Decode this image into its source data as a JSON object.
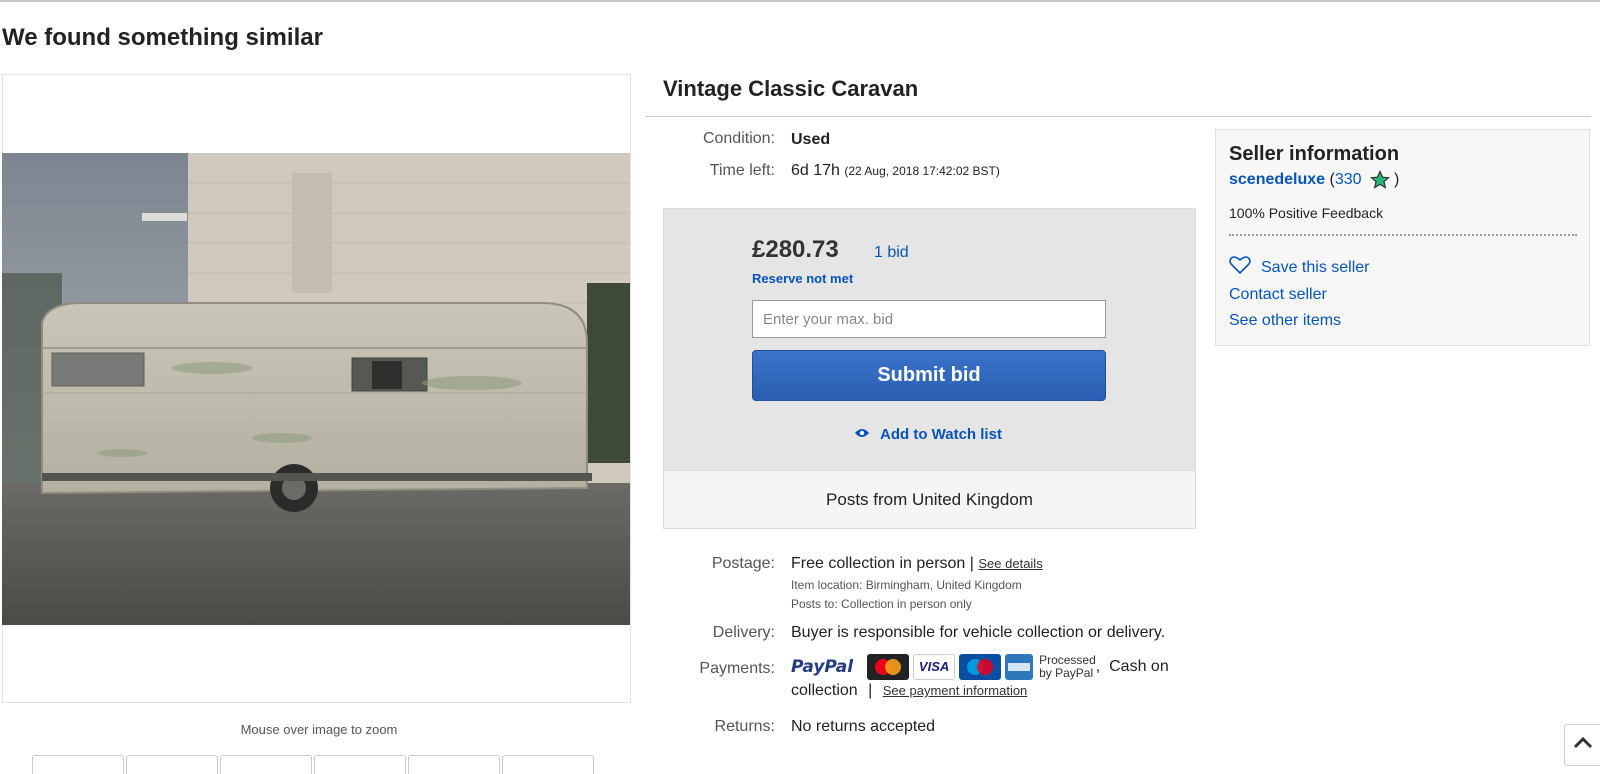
{
  "page": {
    "heading": "We found something similar"
  },
  "gallery": {
    "zoom_hint": "Mouse over image to zoom",
    "thumbnail_count": 6
  },
  "item": {
    "title": "Vintage Classic Caravan",
    "condition_label": "Condition:",
    "condition_value": "Used",
    "time_left_label": "Time left:",
    "time_left_value": "6d 17h",
    "time_left_end": "(22 Aug, 2018   17:42:02 BST)"
  },
  "bid": {
    "price": "£280.73",
    "bid_count": "1 bid",
    "reserve_status": "Reserve not met",
    "input_placeholder": "Enter your max. bid",
    "submit_label": "Submit bid",
    "watch_label": "Add to Watch list",
    "posts_from": "Posts from United Kingdom"
  },
  "shipping": {
    "postage_label": "Postage:",
    "postage_value": "Free collection in person",
    "postage_sep": "|",
    "see_details": "See details",
    "item_location": "Item location:  Birmingham, United Kingdom",
    "posts_to": "Posts to:  Collection in person only",
    "delivery_label": "Delivery:",
    "delivery_value": "Buyer is responsible for vehicle collection or delivery.",
    "payments_label": "Payments:",
    "paypal": "PayPal",
    "card_visa": "VISA",
    "processed_line1": "Processed",
    "processed_line2": "by PayPal",
    "cash_on": ",  Cash on",
    "collection": "collection",
    "pay_sep": "|",
    "see_payment": "See payment information",
    "returns_label": "Returns:",
    "returns_value": "No returns accepted"
  },
  "seller": {
    "title": "Seller information",
    "name": "scenedeluxe",
    "open_paren": " (",
    "feedback_score": "330",
    "close_paren": " )",
    "feedback_pct": "100% Positive Feedback",
    "save_label": "Save this seller",
    "contact_label": "Contact seller",
    "other_items_label": "See other items"
  },
  "colors": {
    "link": "#0654ba",
    "button": "#2b5fb3",
    "star": "#2bb673"
  }
}
